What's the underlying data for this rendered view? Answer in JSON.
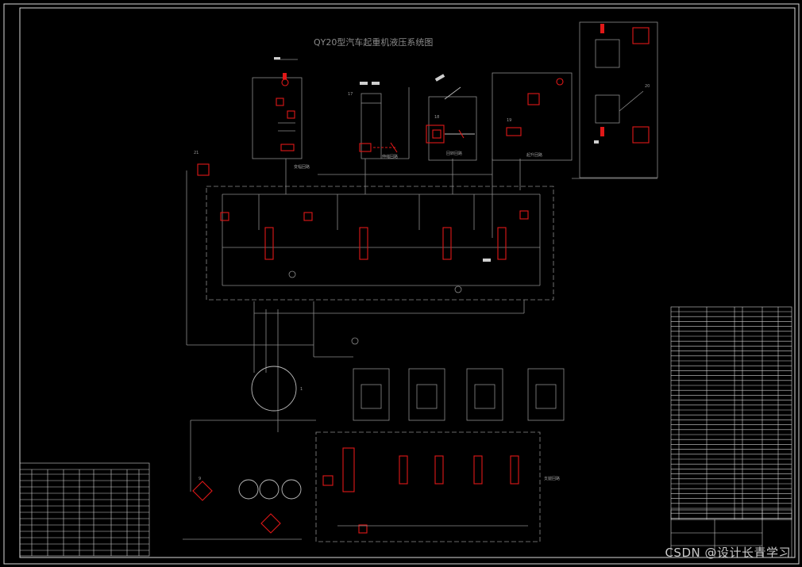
{
  "title": "QY20型汽车起重机液压系统图",
  "circuits": {
    "luffing": "变幅回路",
    "telescoping": "伸缩回路",
    "rotation": "回转回路",
    "hoisting": "起升回路",
    "outrigger": "支腿回路",
    "outrigger_upper": "支腿回路"
  },
  "component_numbers": {
    "n17": "17",
    "n18": "18",
    "n19": "19",
    "n20": "20",
    "n21": "21",
    "n22": "22",
    "n23": "23",
    "n9": "9",
    "n1": "1",
    "n16": "16",
    "n15": "15",
    "n14": "14"
  },
  "watermark": "CSDN @设计长青学习"
}
